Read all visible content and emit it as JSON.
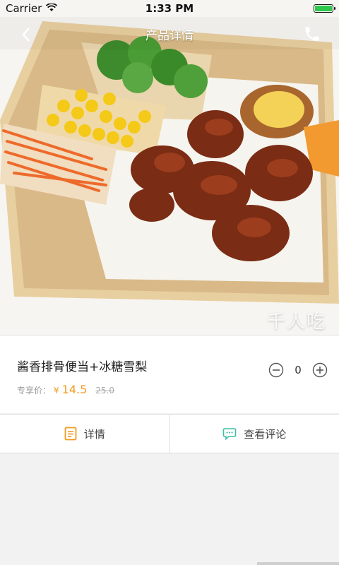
{
  "status_bar": {
    "carrier": "Carrier",
    "time": "1:33 PM",
    "battery_level": 1.0,
    "battery_color": "#2fc84c"
  },
  "nav": {
    "title": "产品详情",
    "back_icon": "chevron-left-icon",
    "phone_icon": "phone-icon"
  },
  "hero": {
    "watermark": "千人吃"
  },
  "product": {
    "name": "酱香排骨便当+冰糖雪梨",
    "price_label": "专享价：",
    "price_symbol": "¥",
    "price": "14.5",
    "original_price": "25.0",
    "quantity": "0",
    "accent_color": "#f29a1f"
  },
  "tabs": [
    {
      "label": "详情",
      "icon": "document-icon"
    },
    {
      "label": "查看评论",
      "icon": "comment-icon"
    }
  ]
}
